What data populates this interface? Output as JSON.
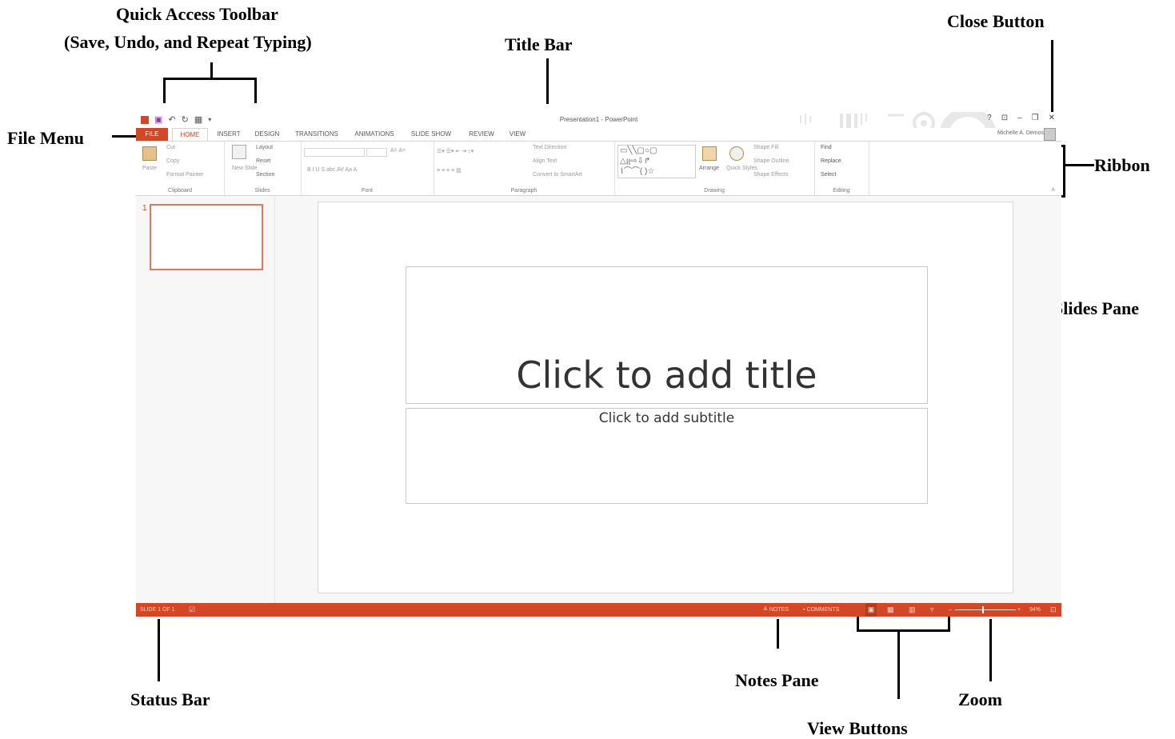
{
  "annotations": {
    "qat_line1": "Quick Access Toolbar",
    "qat_line2": "(Save, Undo, and Repeat Typing)",
    "title_bar": "Title Bar",
    "close_button": "Close Button",
    "file_menu": "File Menu",
    "ribbon": "Ribbon",
    "slides_pane": "Slides Pane",
    "status_bar": "Status Bar",
    "notes_pane": "Notes Pane",
    "view_buttons": "View Buttons",
    "zoom": "Zoom"
  },
  "window": {
    "title": "Presentation1 - PowerPoint",
    "user": "Michelle A. Demos",
    "controls": [
      "?",
      "⊡",
      "–",
      "❐",
      "✕"
    ]
  },
  "tabs": [
    "FILE",
    "HOME",
    "INSERT",
    "DESIGN",
    "TRANSITIONS",
    "ANIMATIONS",
    "SLIDE SHOW",
    "REVIEW",
    "VIEW"
  ],
  "ribbon": {
    "clipboard": {
      "label": "Clipboard",
      "paste": "Paste",
      "cut": "Cut",
      "copy": "Copy",
      "format_painter": "Format Painter"
    },
    "slides": {
      "label": "Slides",
      "new_slide": "New Slide",
      "layout": "Layout",
      "reset": "Reset",
      "section": "Section"
    },
    "font": {
      "label": "Font",
      "buttons": "B  I  U  S  abc  AV  Aa  A"
    },
    "paragraph": {
      "label": "Paragraph",
      "text_direction": "Text Direction",
      "align_text": "Align Text",
      "convert_smartart": "Convert to SmartArt"
    },
    "drawing": {
      "label": "Drawing",
      "arrange": "Arrange",
      "quick_styles": "Quick Styles",
      "shape_fill": "Shape Fill",
      "shape_outline": "Shape Outline",
      "shape_effects": "Shape Effects"
    },
    "editing": {
      "label": "Editing",
      "find": "Find",
      "replace": "Replace",
      "select": "Select"
    }
  },
  "thumbnails": {
    "number": "1"
  },
  "slide": {
    "title_placeholder": "Click to add title",
    "subtitle_placeholder": "Click to add subtitle"
  },
  "status": {
    "slide_info": "SLIDE 1 OF 1",
    "notes": "NOTES",
    "comments": "COMMENTS",
    "zoom": "94%"
  },
  "colors": {
    "accent": "#d24726",
    "accent_light": "#e8745a"
  }
}
